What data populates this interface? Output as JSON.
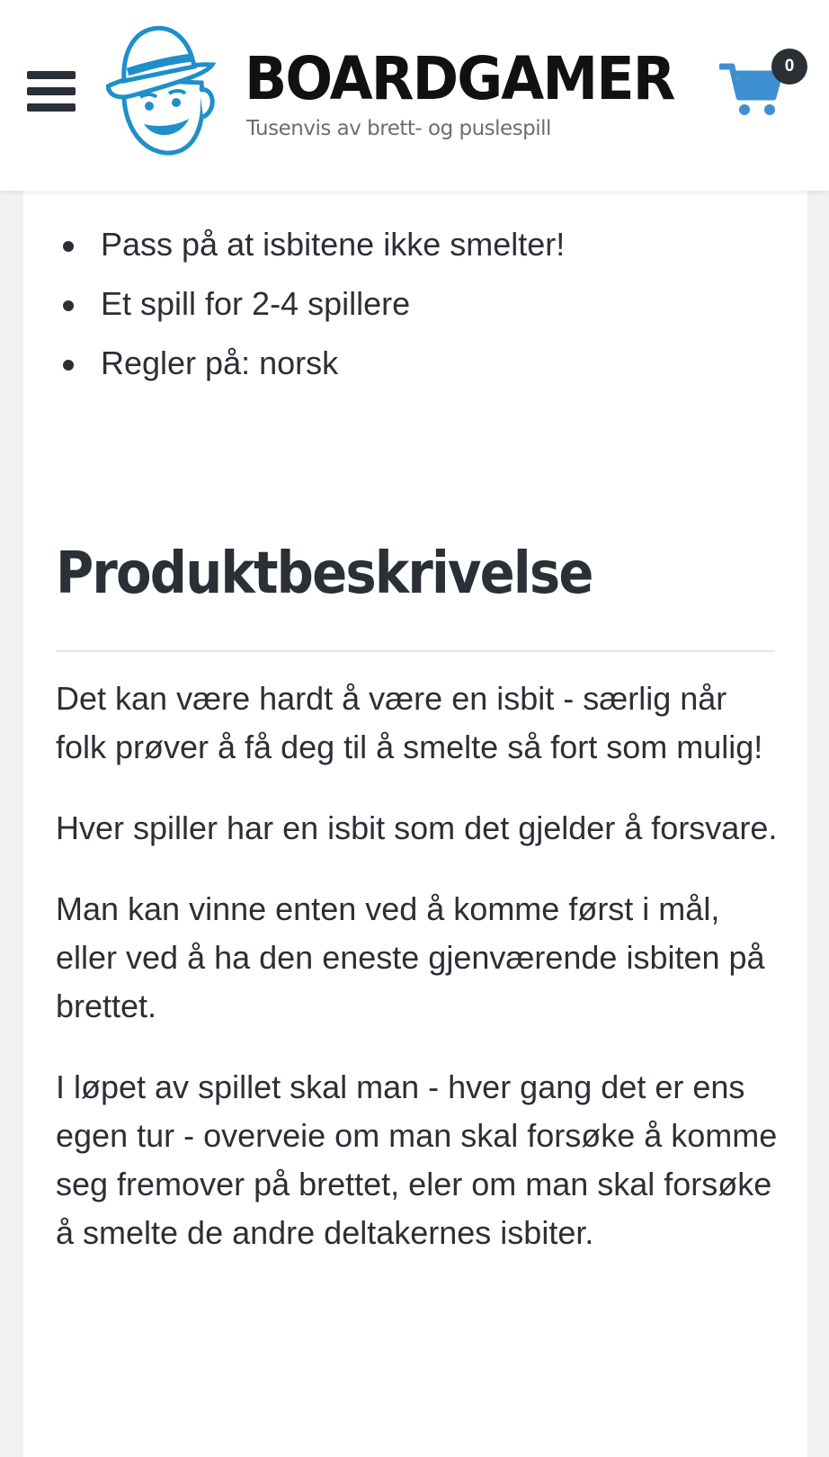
{
  "header": {
    "brand_name": "BOARDGAMER",
    "tagline": "Tusenvis av brett- og puslespill",
    "cart_count": "0"
  },
  "colors": {
    "accent": "#3d8fd1",
    "text": "#2b2f36",
    "background": "#f1f1f2"
  },
  "icons": {
    "menu": "hamburger-icon",
    "cart": "shopping-cart-icon"
  },
  "product": {
    "bullets": [
      "Pass på at isbitene ikke smelter!",
      "Et spill for 2-4 spillere",
      "Regler på: norsk"
    ],
    "section_title": "Produktbeskrivelse",
    "description": [
      "Det kan være hardt å være en isbit - særlig når folk prøver å få deg til å smelte så fort som mulig!",
      "Hver spiller har en isbit som det gjelder å forsvare.",
      "Man kan vinne enten ved å komme først i mål, eller ved å ha den eneste gjenværende isbiten på brettet.",
      "I løpet av spillet skal man - hver gang det er ens egen tur - overveie om man skal forsøke å komme seg fremover på brettet, eler om man skal forsøke å smelte de andre deltakernes isbiter."
    ]
  }
}
